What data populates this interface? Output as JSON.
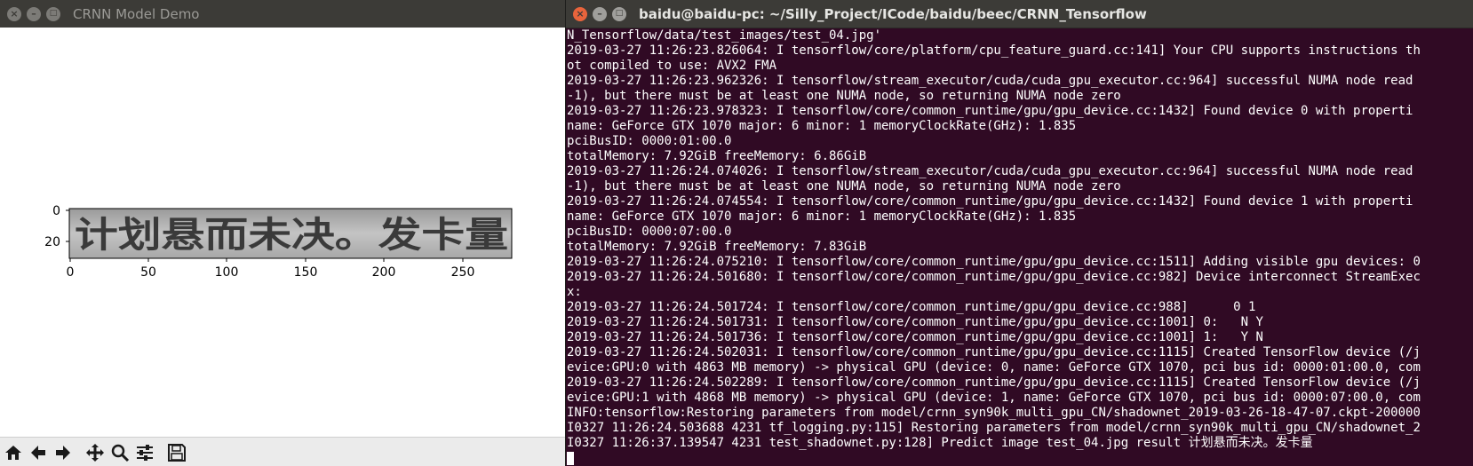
{
  "left_window": {
    "title": "CRNN Model Demo",
    "toolbar": {
      "home_icon": "home-icon",
      "back_icon": "arrow-left-icon",
      "forward_icon": "arrow-right-icon",
      "pan_icon": "move-icon",
      "zoom_icon": "magnifier-icon",
      "subplots_icon": "sliders-icon",
      "save_icon": "floppy-disk-icon"
    },
    "plot": {
      "image_text": "计划悬而未决。发卡量",
      "x_ticks": [
        "0",
        "50",
        "100",
        "150",
        "200",
        "250"
      ],
      "y_ticks": [
        "0",
        "20"
      ]
    }
  },
  "right_window": {
    "title": "baidu@baidu-pc: ~/Silly_Project/ICode/baidu/beec/CRNN_Tensorflow",
    "lines": [
      "N_Tensorflow/data/test_images/test_04.jpg'",
      "2019-03-27 11:26:23.826064: I tensorflow/core/platform/cpu_feature_guard.cc:141] Your CPU supports instructions th",
      "ot compiled to use: AVX2 FMA",
      "2019-03-27 11:26:23.962326: I tensorflow/stream_executor/cuda/cuda_gpu_executor.cc:964] successful NUMA node read",
      "-1), but there must be at least one NUMA node, so returning NUMA node zero",
      "2019-03-27 11:26:23.978323: I tensorflow/core/common_runtime/gpu/gpu_device.cc:1432] Found device 0 with properti",
      "name: GeForce GTX 1070 major: 6 minor: 1 memoryClockRate(GHz): 1.835",
      "pciBusID: 0000:01:00.0",
      "totalMemory: 7.92GiB freeMemory: 6.86GiB",
      "2019-03-27 11:26:24.074026: I tensorflow/stream_executor/cuda/cuda_gpu_executor.cc:964] successful NUMA node read",
      "-1), but there must be at least one NUMA node, so returning NUMA node zero",
      "2019-03-27 11:26:24.074554: I tensorflow/core/common_runtime/gpu/gpu_device.cc:1432] Found device 1 with properti",
      "name: GeForce GTX 1070 major: 6 minor: 1 memoryClockRate(GHz): 1.835",
      "pciBusID: 0000:07:00.0",
      "totalMemory: 7.92GiB freeMemory: 7.83GiB",
      "2019-03-27 11:26:24.075210: I tensorflow/core/common_runtime/gpu/gpu_device.cc:1511] Adding visible gpu devices: 0",
      "2019-03-27 11:26:24.501680: I tensorflow/core/common_runtime/gpu/gpu_device.cc:982] Device interconnect StreamExec",
      "x:",
      "2019-03-27 11:26:24.501724: I tensorflow/core/common_runtime/gpu/gpu_device.cc:988]      0 1",
      "2019-03-27 11:26:24.501731: I tensorflow/core/common_runtime/gpu/gpu_device.cc:1001] 0:   N Y",
      "2019-03-27 11:26:24.501736: I tensorflow/core/common_runtime/gpu/gpu_device.cc:1001] 1:   Y N",
      "2019-03-27 11:26:24.502031: I tensorflow/core/common_runtime/gpu/gpu_device.cc:1115] Created TensorFlow device (/j",
      "evice:GPU:0 with 4863 MB memory) -> physical GPU (device: 0, name: GeForce GTX 1070, pci bus id: 0000:01:00.0, com",
      "2019-03-27 11:26:24.502289: I tensorflow/core/common_runtime/gpu/gpu_device.cc:1115] Created TensorFlow device (/j",
      "evice:GPU:1 with 4868 MB memory) -> physical GPU (device: 1, name: GeForce GTX 1070, pci bus id: 0000:07:00.0, com",
      "INFO:tensorflow:Restoring parameters from model/crnn_syn90k_multi_gpu_CN/shadownet_2019-03-26-18-47-07.ckpt-200000",
      "I0327 11:26:24.503688 4231 tf_logging.py:115] Restoring parameters from model/crnn_syn90k_multi_gpu_CN/shadownet_2",
      "I0327 11:26:37.139547 4231 test_shadownet.py:128] Predict image test_04.jpg result 计划悬而未决。发卡量"
    ]
  }
}
